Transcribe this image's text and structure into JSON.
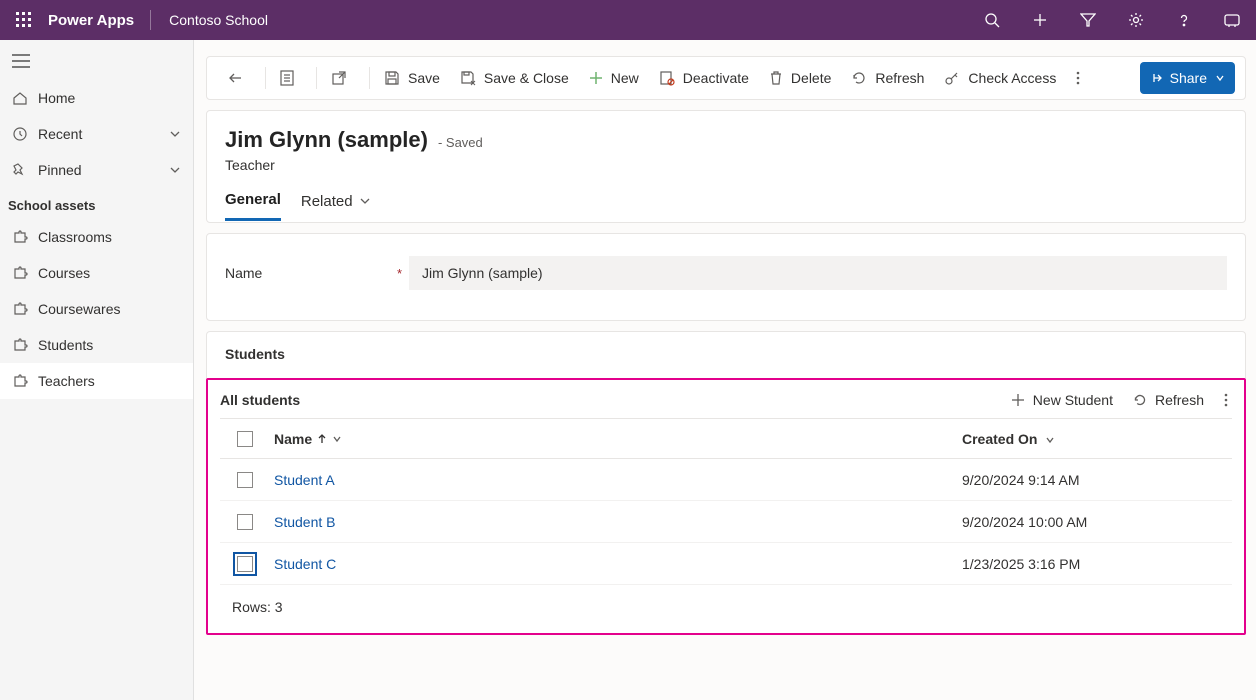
{
  "header": {
    "product": "Power Apps",
    "environment": "Contoso School"
  },
  "sidebar": {
    "home": "Home",
    "recent": "Recent",
    "pinned": "Pinned",
    "group_label": "School assets",
    "items": [
      {
        "label": "Classrooms"
      },
      {
        "label": "Courses"
      },
      {
        "label": "Coursewares"
      },
      {
        "label": "Students"
      },
      {
        "label": "Teachers"
      }
    ]
  },
  "commands": {
    "save": "Save",
    "save_close": "Save & Close",
    "new": "New",
    "deactivate": "Deactivate",
    "delete": "Delete",
    "refresh": "Refresh",
    "check_access": "Check Access",
    "share": "Share"
  },
  "record": {
    "title": "Jim Glynn (sample)",
    "saved_suffix": "- Saved",
    "entity": "Teacher",
    "tabs": {
      "general": "General",
      "related": "Related"
    },
    "name_label": "Name",
    "name_value": "Jim Glynn (sample)"
  },
  "students_section": {
    "title": "Students",
    "view_name": "All students",
    "new_button": "New Student",
    "refresh": "Refresh",
    "columns": {
      "name": "Name",
      "created": "Created On"
    },
    "rows": [
      {
        "name": "Student A",
        "created": "9/20/2024 9:14 AM"
      },
      {
        "name": "Student B",
        "created": "9/20/2024 10:00 AM"
      },
      {
        "name": "Student C",
        "created": "1/23/2025 3:16 PM"
      }
    ],
    "rows_label": "Rows: 3"
  }
}
